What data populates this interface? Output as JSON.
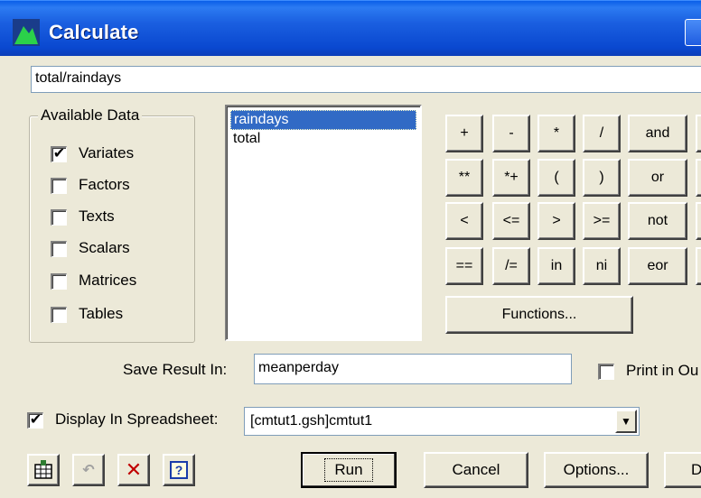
{
  "window": {
    "title": "Calculate"
  },
  "expression": {
    "value": "total/raindays"
  },
  "available_data": {
    "legend": "Available Data",
    "items": [
      {
        "label": "Variates",
        "checked": true
      },
      {
        "label": "Factors",
        "checked": false
      },
      {
        "label": "Texts",
        "checked": false
      },
      {
        "label": "Scalars",
        "checked": false
      },
      {
        "label": "Matrices",
        "checked": false
      },
      {
        "label": "Tables",
        "checked": false
      }
    ]
  },
  "data_list": {
    "items": [
      "raindays",
      "total"
    ],
    "selected": "raindays"
  },
  "operators": {
    "row1": [
      "+",
      "-",
      "*",
      "/",
      "and"
    ],
    "row2": [
      "**",
      "*+",
      "(",
      ")",
      "or"
    ],
    "row3": [
      "<",
      "<=",
      ">",
      ">=",
      "not"
    ],
    "row4": [
      "==",
      "/=",
      "in",
      "ni",
      "eor"
    ],
    "functions_label": "Functions..."
  },
  "save_result": {
    "label": "Save Result In:",
    "value": "meanperday"
  },
  "print_option": {
    "label": "Print in Ou",
    "checked": false
  },
  "spreadsheet": {
    "label": "Display In Spreadsheet:",
    "checked": true,
    "value": "[cmtut1.gsh]cmtut1"
  },
  "toolbar": {
    "icons": [
      "spreadsheet-icon",
      "undo-icon",
      "clear-icon",
      "help-icon"
    ],
    "clear_glyph": "✕",
    "help_glyph": "?",
    "undo_glyph": "↶"
  },
  "commands": {
    "run": "Run",
    "cancel": "Cancel",
    "options": "Options...",
    "defaults": "D"
  },
  "colors": {
    "titlebar": "#0a48d0",
    "selection": "#316ac5",
    "dialog_bg": "#ece9d8",
    "clear_red": "#c00000"
  }
}
